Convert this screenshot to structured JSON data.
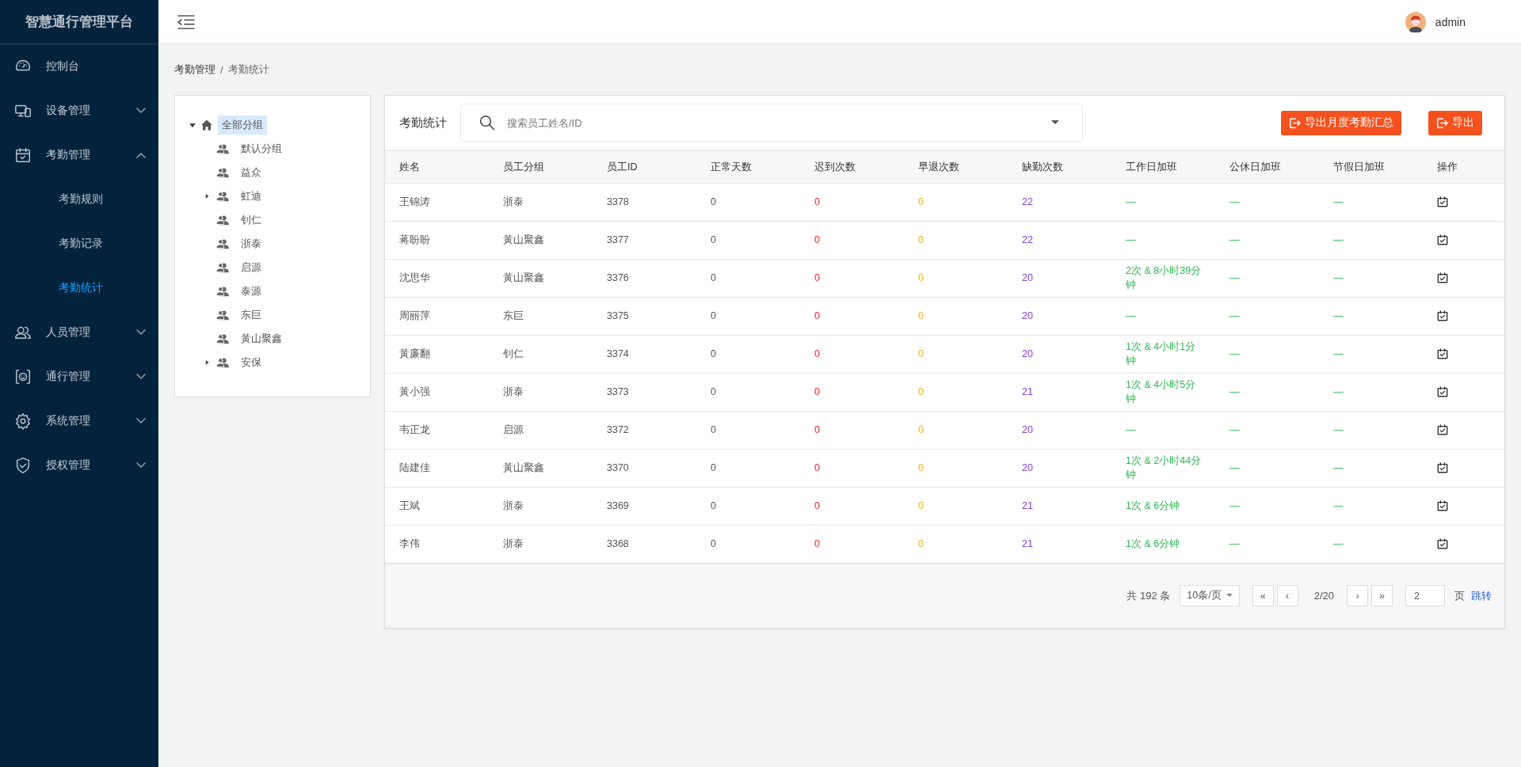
{
  "sidebar": {
    "title": "智慧通行管理平台",
    "items": [
      {
        "label": "控制台"
      },
      {
        "label": "设备管理",
        "expanded": false
      },
      {
        "label": "考勤管理",
        "expanded": true,
        "children": [
          {
            "label": "考勤规则",
            "selected": false
          },
          {
            "label": "考勤记录",
            "selected": false
          },
          {
            "label": "考勤统计",
            "selected": true
          }
        ]
      },
      {
        "label": "人员管理",
        "expanded": false
      },
      {
        "label": "通行管理",
        "expanded": false
      },
      {
        "label": "系统管理",
        "expanded": false
      },
      {
        "label": "授权管理",
        "expanded": false
      }
    ]
  },
  "header": {
    "user": "admin"
  },
  "breadcrumb": {
    "separator": "/",
    "items": [
      "考勤管理",
      "考勤统计"
    ]
  },
  "tree": {
    "label": "全部分组",
    "expanded": true,
    "selected": true,
    "children": [
      {
        "label": "默认分组",
        "collapsed": false,
        "selected": false
      },
      {
        "label": "益众",
        "collapsed": false,
        "selected": false
      },
      {
        "label": "虹迪",
        "collapsed": true,
        "selected": false
      },
      {
        "label": "钊仁",
        "collapsed": false,
        "selected": false
      },
      {
        "label": "浙泰",
        "collapsed": false,
        "selected": false
      },
      {
        "label": "启源",
        "collapsed": false,
        "selected": false
      },
      {
        "label": "泰源",
        "collapsed": false,
        "selected": false
      },
      {
        "label": "东巨",
        "collapsed": false,
        "selected": false
      },
      {
        "label": "黃山聚鑫",
        "collapsed": false,
        "selected": false
      },
      {
        "label": "安保",
        "collapsed": true,
        "selected": false
      }
    ]
  },
  "panel": {
    "title": "考勤统计",
    "search": {
      "placeholder": "搜索员工姓名/ID"
    },
    "buttons": [
      "导出月度考勤汇总",
      "导出"
    ]
  },
  "table": {
    "columns": [
      "姓名",
      "员工分组",
      "员工ID",
      "正常天数",
      "迟到次数",
      "早退次数",
      "缺勤次数",
      "工作日加班",
      "公休日加班",
      "节假日加班",
      "操作"
    ],
    "rows": [
      [
        "王锦涛",
        "浙泰",
        "3378",
        "0",
        "0",
        "0",
        "22",
        "—",
        "—",
        "—"
      ],
      [
        "蒋盼盼",
        "黃山聚鑫",
        "3377",
        "0",
        "0",
        "0",
        "22",
        "—",
        "—",
        "—"
      ],
      [
        "沈思华",
        "黃山聚鑫",
        "3376",
        "0",
        "0",
        "0",
        "20",
        "2次 & 8小时39分钟",
        "—",
        "—"
      ],
      [
        "周丽萍",
        "东巨",
        "3375",
        "0",
        "0",
        "0",
        "20",
        "—",
        "—",
        "—"
      ],
      [
        "黃廉翻",
        "钊仁",
        "3374",
        "0",
        "0",
        "0",
        "20",
        "1次 & 4小时1分钟",
        "—",
        "—"
      ],
      [
        "黃小强",
        "浙泰",
        "3373",
        "0",
        "0",
        "0",
        "21",
        "1次 & 4小时5分钟",
        "—",
        "—"
      ],
      [
        "韦正龙",
        "启源",
        "3372",
        "0",
        "0",
        "0",
        "20",
        "—",
        "—",
        "—"
      ],
      [
        "陆建佳",
        "黃山聚鑫",
        "3370",
        "0",
        "0",
        "0",
        "20",
        "1次 & 2小时44分钟",
        "—",
        "—"
      ],
      [
        "王斌",
        "浙泰",
        "3369",
        "0",
        "0",
        "0",
        "21",
        "1次 & 6分钟",
        "—",
        "—"
      ],
      [
        "李伟",
        "浙泰",
        "3368",
        "0",
        "0",
        "0",
        "21",
        "1次 & 6分钟",
        "—",
        "—"
      ]
    ]
  },
  "pagination": {
    "total": "共 192 条",
    "page_size": "10条/页",
    "first": "«",
    "prev": "‹",
    "page": "2/20",
    "next": "›",
    "last": "»",
    "jump_value": "2",
    "page_unit": "页",
    "jump": "跳转"
  }
}
